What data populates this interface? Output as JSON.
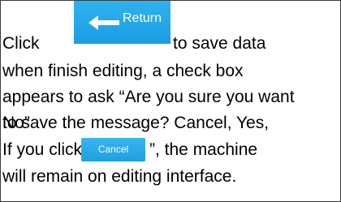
{
  "instructions": {
    "line1_prefix": "Click",
    "line1_suffix": "to save data",
    "line2": "when finish editing, a check box",
    "line3": "appears to ask “Are you sure you want",
    "line4": "to save the message? Cancel, Yes,",
    "line5": "No”",
    "line6_prefix": "If you click “",
    "line6_suffix": "”, the machine",
    "line7": "will remain on editing interface."
  },
  "buttons": {
    "return_label": "Return",
    "cancel_label": "Cancel",
    "return_icon": "return-arrow-icon"
  },
  "colors": {
    "button_blue": "#1b9ee1",
    "text": "#000000",
    "border": "#3a3a3a"
  }
}
